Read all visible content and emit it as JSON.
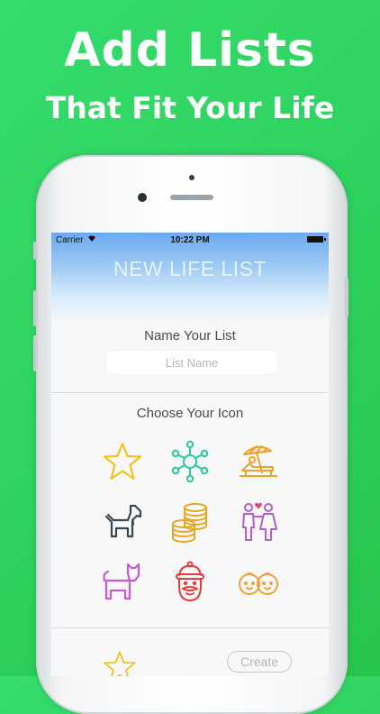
{
  "promo": {
    "headline": "Add Lists",
    "subheadline": "That Fit Your Life"
  },
  "status_bar": {
    "carrier": "Carrier",
    "time": "10:22 PM"
  },
  "screen": {
    "title": "NEW LIFE LIST",
    "name_label": "Name Your List",
    "name_placeholder": "List Name",
    "icon_label": "Choose Your Icon",
    "create_label": "Create"
  },
  "icons": [
    {
      "name": "star-icon",
      "color": "#f2c31a"
    },
    {
      "name": "network-icon",
      "color": "#27c9a0"
    },
    {
      "name": "beach-lounger-icon",
      "color": "#f0a128"
    },
    {
      "name": "dog-icon",
      "color": "#3a4750"
    },
    {
      "name": "coins-icon",
      "color": "#e9a623"
    },
    {
      "name": "couple-icon",
      "color": "#b75ccd"
    },
    {
      "name": "cat-icon",
      "color": "#c45bd0"
    },
    {
      "name": "santa-icon",
      "color": "#e63b3b"
    },
    {
      "name": "baby-faces-icon",
      "color": "#f3a03a"
    }
  ],
  "colors": {
    "background_green": "#2fd25f",
    "hero_blue": "#6aa9f0"
  }
}
